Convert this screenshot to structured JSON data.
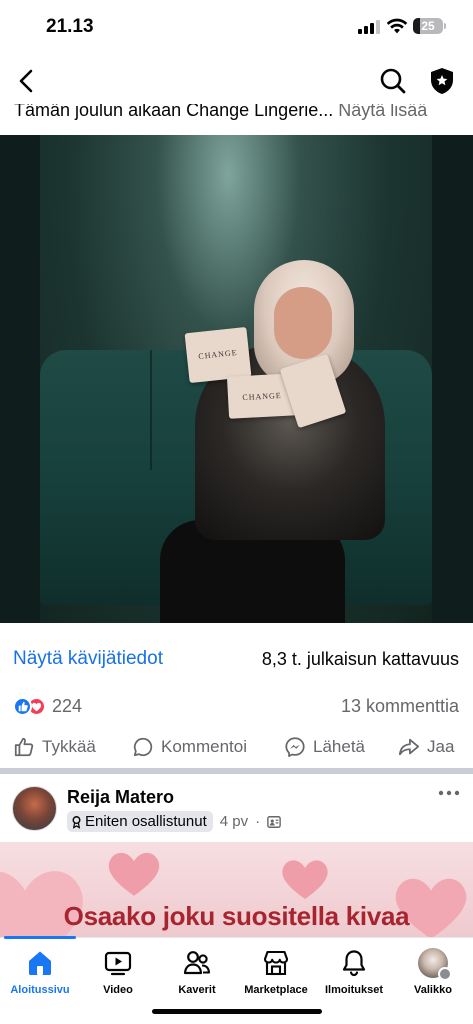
{
  "status_bar": {
    "time": "21.13",
    "battery": "25"
  },
  "header": {
    "back_icon": "chevron-left-icon",
    "search_icon": "search-icon",
    "shield_icon": "shield-star-icon"
  },
  "post": {
    "caption": "Tämän joulun aikaan Change Lingerie...",
    "see_more": "Näytä lisää",
    "gift_brand": "CHANGE",
    "insights_link": "Näytä kävijätiedot",
    "reach": "8,3 t. julkaisun kattavuus",
    "reaction_count": "224",
    "comment_count": "13 kommenttia",
    "actions": {
      "like": "Tykkää",
      "comment": "Kommentoi",
      "send": "Lähetä",
      "share": "Jaa"
    }
  },
  "next_post": {
    "author": "Reija Matero",
    "badge": "Eniten osallistunut",
    "time": "4 pv",
    "banner_text": "Osaako joku suositella kivaa"
  },
  "tabs": [
    {
      "label": "Aloitussivu",
      "icon": "home-icon",
      "active": true
    },
    {
      "label": "Video",
      "icon": "video-icon",
      "active": false
    },
    {
      "label": "Kaverit",
      "icon": "friends-icon",
      "active": false
    },
    {
      "label": "Marketplace",
      "icon": "marketplace-icon",
      "active": false
    },
    {
      "label": "Ilmoitukset",
      "icon": "bell-icon",
      "active": false
    },
    {
      "label": "Valikko",
      "icon": "profile-avatar",
      "active": false
    }
  ],
  "colors": {
    "accent": "#1877f2",
    "muted": "#65676b",
    "banner_text": "#a8242f"
  }
}
